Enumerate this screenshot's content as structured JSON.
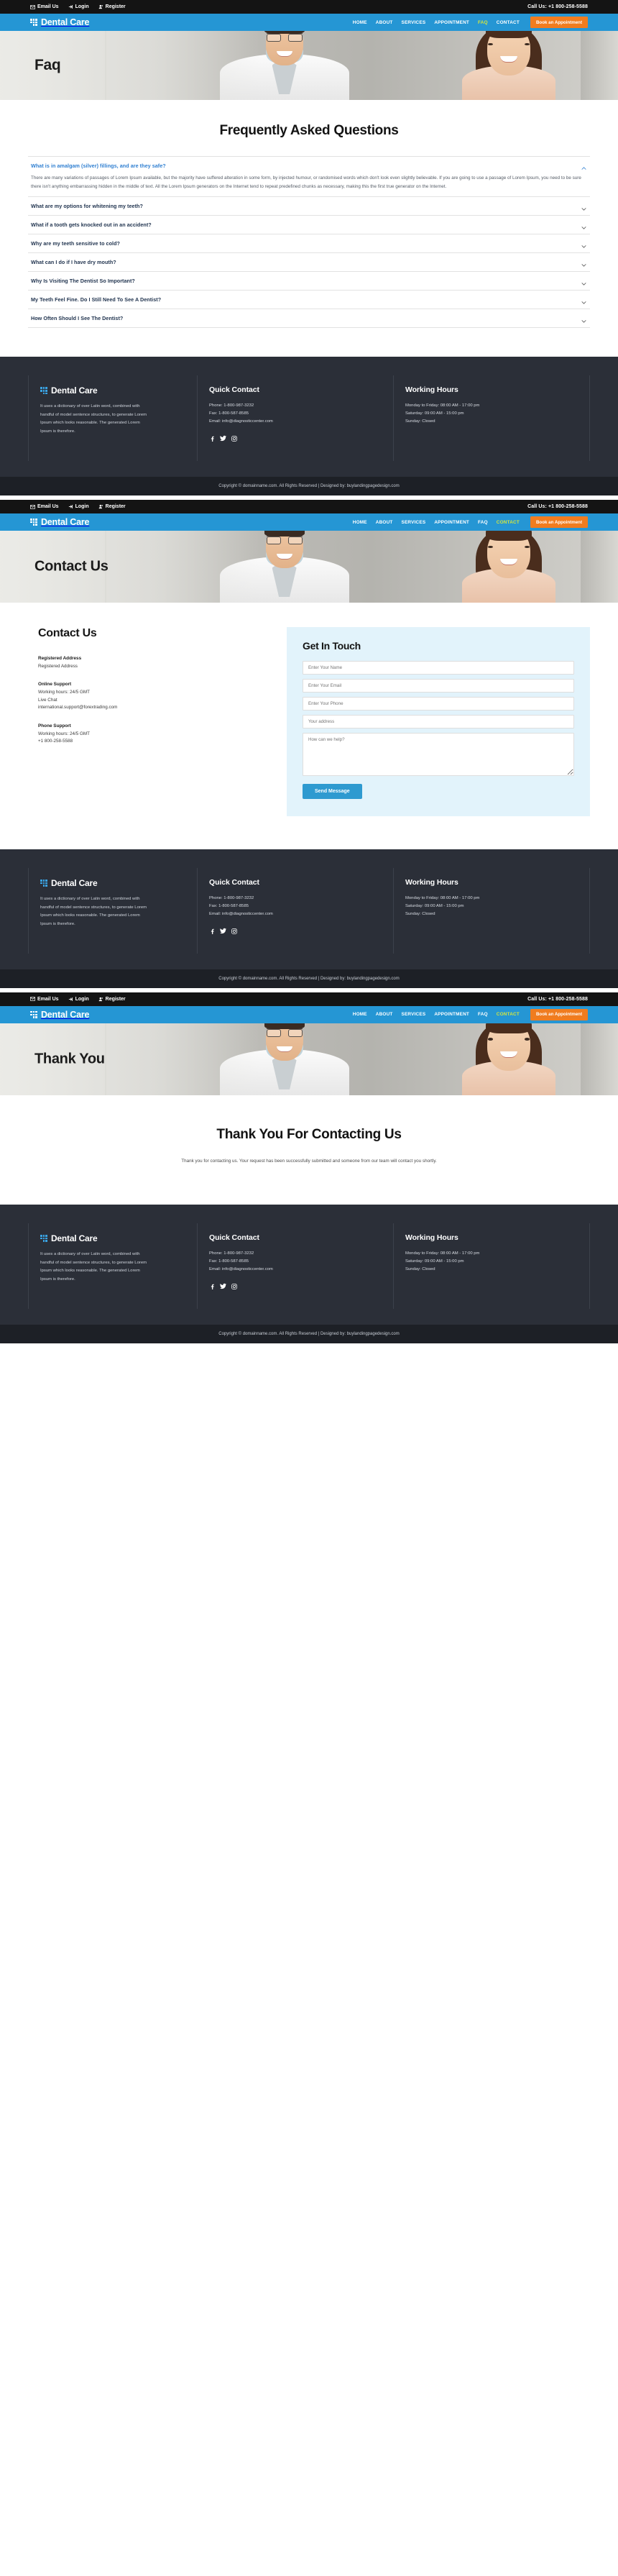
{
  "site": {
    "brand_name": "Dental Care",
    "accent_blue": "#2596d4",
    "accent_orange": "#f07c1f",
    "active_nav_color": "#d6e63b",
    "footer_bg": "#2b2f38"
  },
  "topbar": {
    "email_label": "Email Us",
    "login_label": "Login",
    "register_label": "Register",
    "phone_label": "Call Us: +1 800-258-5588",
    "icons": {
      "email": "envelope-icon",
      "login": "sign-in-icon",
      "register": "user-plus-icon"
    }
  },
  "nav": {
    "items": [
      {
        "label": "HOME",
        "active": false
      },
      {
        "label": "ABOUT",
        "active": false
      },
      {
        "label": "SERVICES",
        "active": false
      },
      {
        "label": "APPOINTMENT",
        "active": false
      },
      {
        "label": "FAQ",
        "active": true
      },
      {
        "label": "CONTACT",
        "active": false
      }
    ],
    "items_contact": [
      {
        "label": "HOME",
        "active": false
      },
      {
        "label": "ABOUT",
        "active": false
      },
      {
        "label": "SERVICES",
        "active": false
      },
      {
        "label": "APPOINTMENT",
        "active": false
      },
      {
        "label": "FAQ",
        "active": false
      },
      {
        "label": "CONTACT",
        "active": true
      }
    ],
    "cta_label": "Book an Appointment"
  },
  "pages": {
    "faq": {
      "hero_title": "Faq",
      "heading": "Frequently Asked Questions",
      "items": [
        {
          "question": "What is in amalgam (silver) fillings, and are they safe?",
          "open": true,
          "answer": "There are many variations of passages of Lorem Ipsum available, but the majority have suffered alteration in some form, by injected humour, or randomised words which don't look even slightly believable. If you are going to use a passage of Lorem Ipsum, you need to be sure there isn't anything embarrassing hidden in the middle of text. All the Lorem Ipsum generators on the Internet tend to repeat predefined chunks as necessary, making this the first true generator on the Internet."
        },
        {
          "question": "What are my options for whitening my teeth?",
          "open": false,
          "answer": ""
        },
        {
          "question": "What if a tooth gets knocked out in an accident?",
          "open": false,
          "answer": ""
        },
        {
          "question": "Why are my teeth sensitive to cold?",
          "open": false,
          "answer": ""
        },
        {
          "question": "What can I do if I have dry mouth?",
          "open": false,
          "answer": ""
        },
        {
          "question": "Why Is Visiting The Dentist So Important?",
          "open": false,
          "answer": ""
        },
        {
          "question": "My Teeth Feel Fine. Do I Still Need To See A Dentist?",
          "open": false,
          "answer": ""
        },
        {
          "question": "How Often Should I See The Dentist?",
          "open": false,
          "answer": ""
        }
      ]
    },
    "contact": {
      "hero_title": "Contact Us",
      "heading": "Contact Us",
      "blocks": [
        {
          "title": "Registered Address",
          "lines": "Registered Address"
        },
        {
          "title": "Online Support",
          "lines": "Working hours: 24/5 GMT\nLive Chat\ninternational.support@forextrading.com"
        },
        {
          "title": "Phone Support",
          "lines": "Working hours: 24/5 GMT\n+1 800-258-5588"
        }
      ],
      "form": {
        "title": "Get In Touch",
        "name_placeholder": "Enter Your Name",
        "email_placeholder": "Enter Your Email",
        "phone_placeholder": "Enter Your Phone",
        "address_placeholder": "Your address",
        "message_placeholder": "How can we help?",
        "name_value": "",
        "email_value": "",
        "phone_value": "",
        "address_value": "",
        "message_value": "",
        "submit_label": "Send Message"
      }
    },
    "thankyou": {
      "hero_title": "Thank You",
      "heading": "Thank You For Contacting Us",
      "text": "Thank you for contacting us. Your request has been successfully submitted and someone from our team will contact you shortly."
    }
  },
  "footer": {
    "brand_name": "Dental Care",
    "about_text": "It uses a dictionary of over Latin word, combined with handful of model sentence structures, to generate Lorem Ipsum which looks reasonable. The generated Lorem Ipsum is therefore.",
    "quick_contact": {
      "title": "Quick Contact",
      "phone": "Phone: 1-800-987-3232",
      "fax": "Fax: 1-800-587-8585",
      "email": "Email: info@diagnosticcenter.com",
      "socials": [
        "facebook-icon",
        "twitter-icon",
        "instagram-icon"
      ]
    },
    "working_hours": {
      "title": "Working Hours",
      "weekday": "Monday to Friday: 08:00 AM - 17:00 pm",
      "saturday": "Saturday: 09:00 AM - 15:00 pm",
      "sunday": "Sunday: Closed"
    },
    "copyright": "Copyright © domainname.com. All Rights Reserved | Designed by: buylandingpagedesign.com"
  }
}
